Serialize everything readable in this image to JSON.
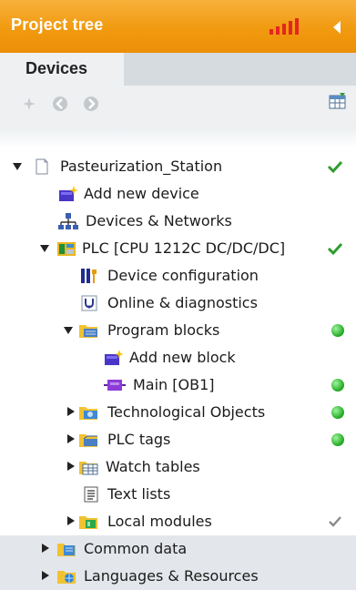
{
  "panel": {
    "title": "Project tree"
  },
  "tabs": {
    "devices": "Devices"
  },
  "colors": {
    "accent": "#f19a10",
    "ok_green": "#1fa61f",
    "check_green": "#2f9c2f",
    "check_gray": "#8a8a8a"
  },
  "tree": {
    "rows": [
      {
        "label": "Pasteurization_Station",
        "icon": "project-icon",
        "status": "check-green"
      },
      {
        "label": "Add new device",
        "icon": "add-new-device-icon"
      },
      {
        "label": "Devices & Networks",
        "icon": "devices-networks-icon"
      },
      {
        "label": "PLC [CPU 1212C DC/DC/DC]",
        "icon": "plc-icon",
        "status": "check-green"
      },
      {
        "label": "Device configuration",
        "icon": "device-configuration-icon"
      },
      {
        "label": "Online & diagnostics",
        "icon": "online-diagnostics-icon"
      },
      {
        "label": "Program blocks",
        "icon": "folder-icon",
        "status": "ok-dot"
      },
      {
        "label": "Add new block",
        "icon": "add-new-block-icon"
      },
      {
        "label": "Main [OB1]",
        "icon": "ob-block-icon",
        "status": "ok-dot"
      },
      {
        "label": "Technological Objects",
        "icon": "folder-icon",
        "status": "ok-dot"
      },
      {
        "label": "PLC tags",
        "icon": "folder-icon",
        "status": "ok-dot"
      },
      {
        "label": "Watch tables",
        "icon": "watch-table-icon"
      },
      {
        "label": "Text lists",
        "icon": "text-list-icon"
      },
      {
        "label": "Local modules",
        "icon": "folder-icon",
        "status": "check-gray"
      },
      {
        "label": "Common data",
        "icon": "folder-icon"
      },
      {
        "label": "Languages & Resources",
        "icon": "folder-icon"
      }
    ]
  }
}
